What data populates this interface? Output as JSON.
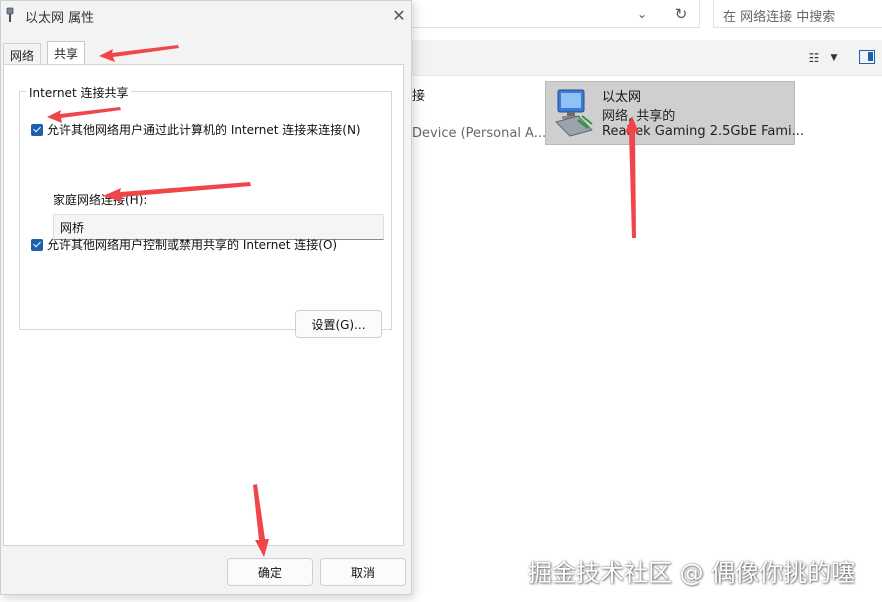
{
  "explorer": {
    "search_placeholder": "在 网络连接 中搜索",
    "partial_col1_top": "接",
    "partial_col1_bottom": "Device (Personal A...",
    "adapter": {
      "name": "以太网",
      "status": "网络, 共享的",
      "device": "Realtek Gaming 2.5GbE Fami..."
    }
  },
  "dialog": {
    "title": "以太网 属性",
    "tabs": [
      {
        "label": "网络"
      },
      {
        "label": "共享"
      }
    ],
    "group_title": "Internet 连接共享",
    "allow_share_label": "允许其他网络用户通过此计算机的 Internet 连接来连接(N)",
    "home_network_label": "家庭网络连接(H):",
    "home_network_value": "网桥",
    "allow_control_label": "允许其他网络用户控制或禁用共享的 Internet 连接(O)",
    "settings_label": "设置(G)...",
    "ok_label": "确定",
    "cancel_label": "取消"
  },
  "watermark": "掘金技术社区 @ 偶像你挑的噻",
  "colors": {
    "accent": "#1f5fae",
    "arrow": "#f0464a",
    "tile_selected": "#cfcfcf"
  }
}
